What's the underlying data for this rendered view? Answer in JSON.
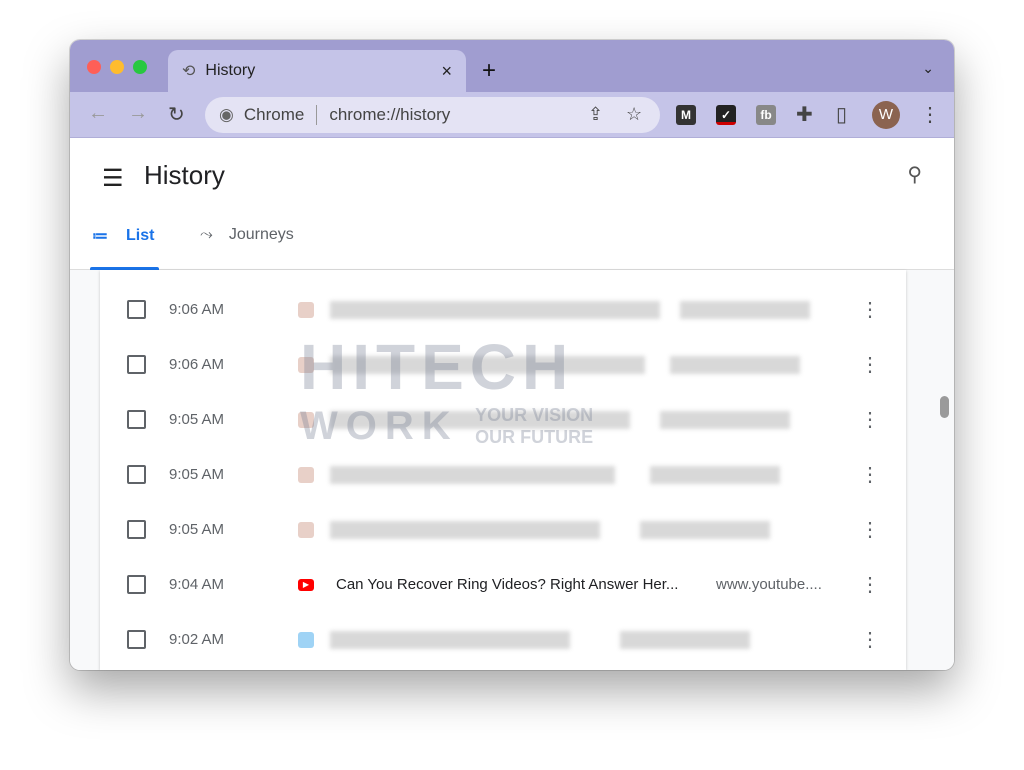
{
  "browser": {
    "tab_title": "History",
    "tab_close": "×",
    "new_tab": "+",
    "tab_list": "⌄",
    "omnibox": {
      "site_label": "Chrome",
      "url": "chrome://history"
    },
    "avatar_initial": "W",
    "extensions": [
      "M",
      "✓",
      "fb"
    ]
  },
  "page": {
    "title": "History",
    "tabs": [
      {
        "label": "List",
        "active": true
      },
      {
        "label": "Journeys",
        "active": false
      }
    ]
  },
  "history": [
    {
      "time": "9:06 AM",
      "title": "",
      "domain": "",
      "blurred": true
    },
    {
      "time": "9:06 AM",
      "title": "",
      "domain": "",
      "blurred": true
    },
    {
      "time": "9:05 AM",
      "title": "",
      "domain": "",
      "blurred": true
    },
    {
      "time": "9:05 AM",
      "title": "",
      "domain": "",
      "blurred": true
    },
    {
      "time": "9:05 AM",
      "title": "",
      "domain": "",
      "blurred": true
    },
    {
      "time": "9:04 AM",
      "title": "Can You Recover Ring Videos? Right Answer Her...",
      "domain": "www.youtube....",
      "blurred": false,
      "favicon": "youtube"
    },
    {
      "time": "9:02 AM",
      "title": "",
      "domain": "",
      "blurred": true
    }
  ],
  "watermark": {
    "line1": "HITECH",
    "line2": "WORK",
    "tag1": "YOUR VISION",
    "tag2": "OUR FUTURE"
  },
  "colors": {
    "accent": "#1a73e8",
    "titlebar": "#a09dd0",
    "toolbar": "#c5c4e8",
    "youtube": "#ff0000"
  }
}
